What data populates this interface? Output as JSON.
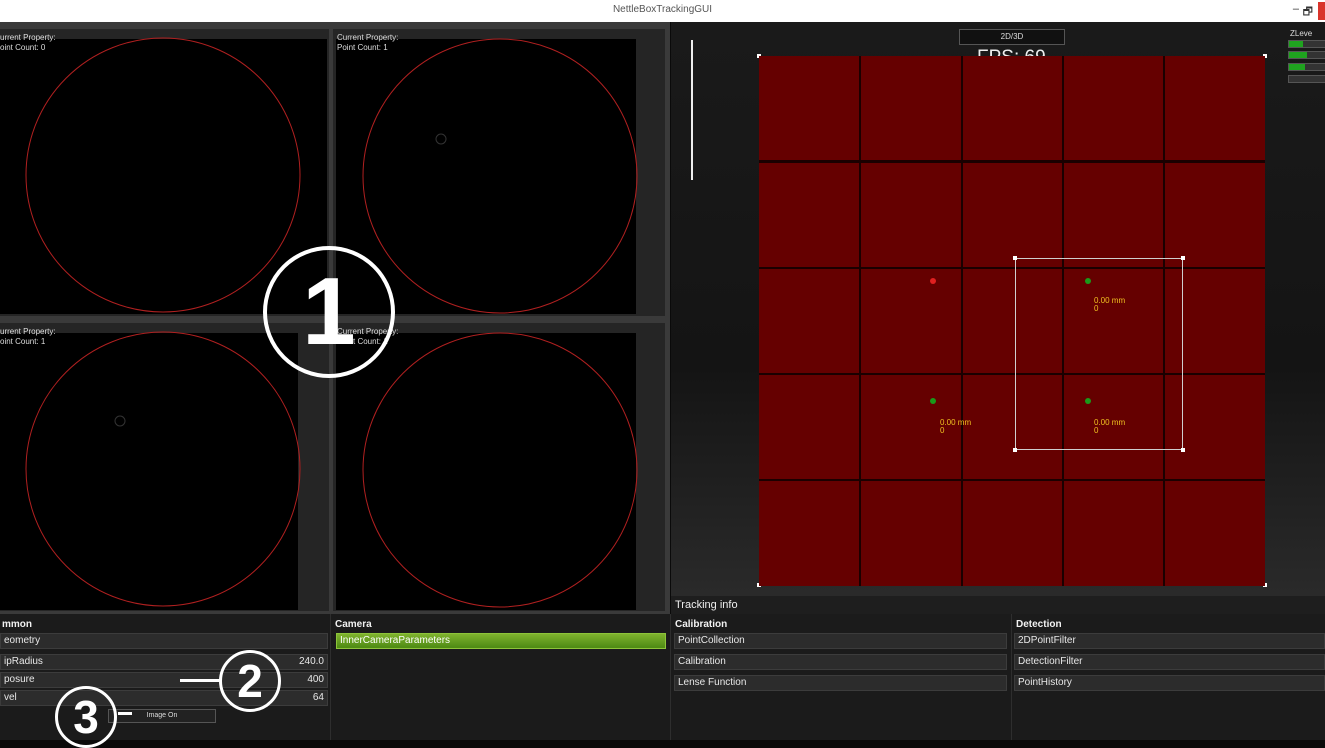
{
  "window": {
    "title": "NettleBoxTrackingGUI",
    "minimize_glyph": "–",
    "restore_glyph": "🗗"
  },
  "cameras": [
    {
      "property": "urrent Property:",
      "count": "oint Count: 0"
    },
    {
      "property": "Current Property:",
      "count": "Point Count: 1"
    },
    {
      "property": "urrent Property:",
      "count": "oint Count: 1"
    },
    {
      "property": "Current Property:",
      "count": "Point Count: 1"
    }
  ],
  "markers": {
    "one": "1",
    "two": "2",
    "three": "3"
  },
  "view3d": {
    "toggle_label": "2D/3D",
    "fps": "FPS: 69",
    "zlevel_label": "ZLeve",
    "zlevel_fills": [
      0.4,
      0.5,
      0.45,
      0.0
    ],
    "measure_a": "0.00 mm\n0",
    "measure_b": "0.00 mm\n0",
    "measure_c": "0.00 mm\n0"
  },
  "tracking_info": "Tracking info",
  "common": {
    "header": "mmon",
    "rows": [
      {
        "label": "eometry",
        "value": ""
      },
      {
        "label": "ipRadius",
        "value": "240.0"
      },
      {
        "label": "posure",
        "value": "400"
      },
      {
        "label": "vel",
        "value": "64"
      }
    ],
    "image_button": "Image On"
  },
  "camera_panel": {
    "header": "Camera",
    "items": [
      "InnerCameraParameters"
    ]
  },
  "calibration": {
    "header": "Calibration",
    "items": [
      "PointCollection",
      "Calibration",
      "Lense Function"
    ]
  },
  "detection": {
    "header": "Detection",
    "items": [
      "2DPointFilter",
      "DetectionFilter",
      "PointHistory"
    ]
  },
  "colors": {
    "tile": "#650000",
    "accent_green": "#6aa321",
    "dot_red": "#e02020",
    "dot_green": "#1a9a1a",
    "label_yellow": "#f0c020"
  }
}
